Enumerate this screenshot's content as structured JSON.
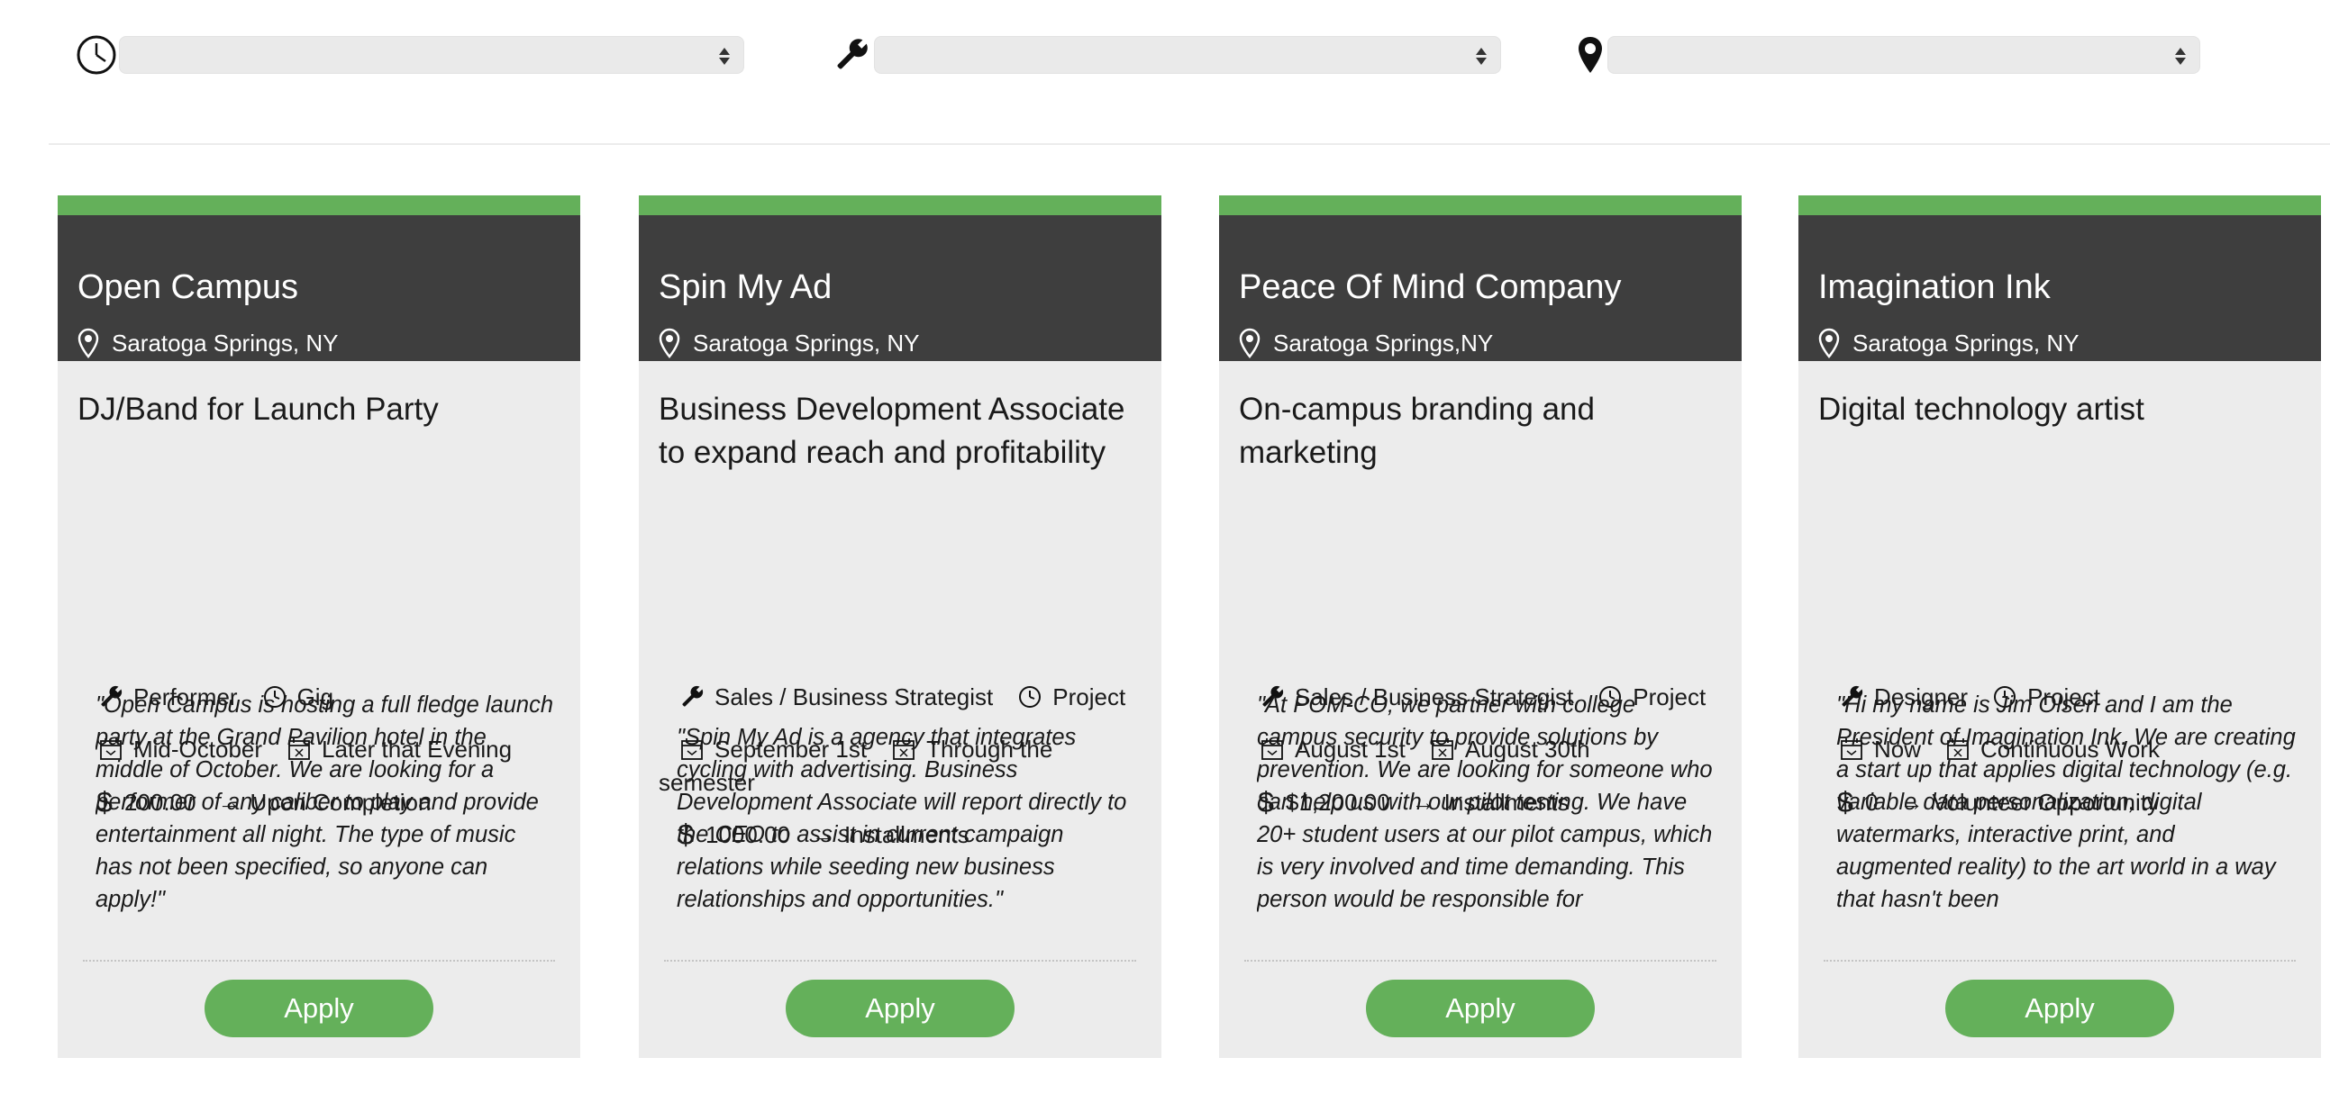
{
  "filters": [
    {
      "icon": "clock-icon",
      "value": ""
    },
    {
      "icon": "wrench-icon",
      "value": ""
    },
    {
      "icon": "map-pin-icon",
      "value": ""
    }
  ],
  "apply_label": "Apply",
  "colors": {
    "accent": "#64b05a",
    "header": "#3e3e3e",
    "card_bg": "#ececec"
  },
  "cards": [
    {
      "company": "Open Campus",
      "location": "Saratoga Springs, NY",
      "title": "DJ/Band for Launch Party",
      "role": "Performer",
      "type": "Gig",
      "start": "Mid-October",
      "end": "Later that Evening",
      "pay": "200.00",
      "payment": "Upon Completion",
      "description": "\"Open Campus is hosting a full fledge launch party at the Grand Pavilion hotel in the middle of October. We are looking for a performer of any caliber to play and provide entertainment all night. The type of music has not been specified, so anyone can apply!\""
    },
    {
      "company": "Spin My Ad",
      "location": "Saratoga Springs, NY",
      "title": "Business Development Associate to expand reach and profitability",
      "role": "Sales / Business Strategist",
      "type": "Project",
      "start": "September 1st",
      "end": "Through the",
      "end_cont": "semester",
      "pay": "1000.00",
      "payment": "Installments",
      "description": "\"Spin My Ad is a agency that integrates cycling with advertising. Business Development Associate will report directly to the CEO to assist in current campaign relations while seeding new business relationships and opportunities.\""
    },
    {
      "company": "Peace Of Mind Company",
      "location": "Saratoga Springs,NY",
      "title": "On-campus branding and marketing",
      "role": "Sales / Business Strategist",
      "type": "Project",
      "start": "August 1st",
      "end": "August 30th",
      "pay": "$1,200.00",
      "payment": "Installments",
      "description": "\"At POM-CO, we partner with college campus security to provide solutions by prevention. We are looking for someone who can help us with our pilot testing. We have 20+ student users at our pilot campus, which is very involved and time demanding. This person would be responsible for"
    },
    {
      "company": "Imagination Ink",
      "location": "Saratoga Springs, NY",
      "title": "Digital technology artist",
      "role": "Designer",
      "type": "Project",
      "start": "Now",
      "end": "Continuous Work",
      "pay": "0",
      "payment": "Volunteer Opportunity",
      "description": "\"Hi my name is Jim Olsen and I am the President of Imagination Ink. We are creating a start up that applies digital technology (e.g. variable data personalization, digital watermarks, interactive print, and augmented reality) to the art world in a way that hasn't been"
    }
  ]
}
